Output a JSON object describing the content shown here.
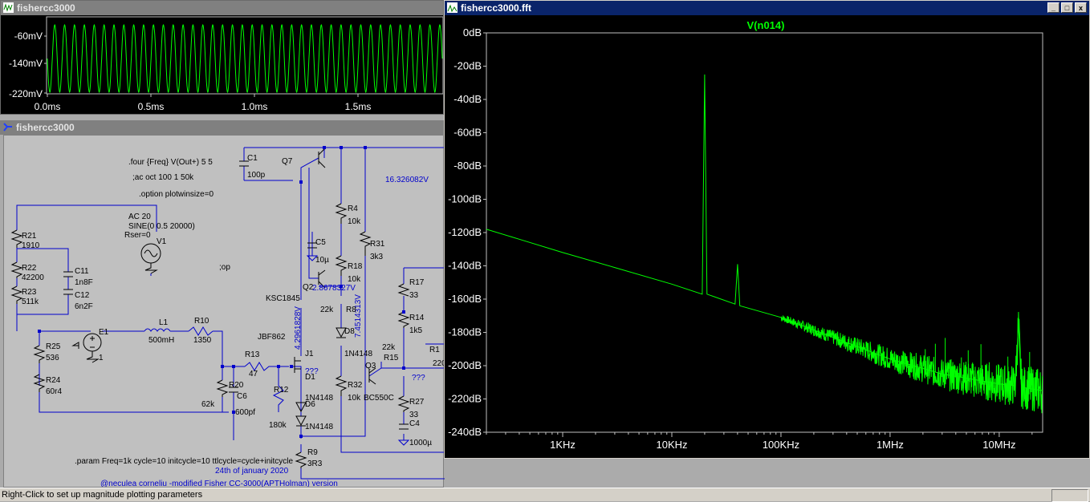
{
  "waveform_window": {
    "title": "fishercc3000",
    "y_ticks": [
      "-60mV",
      "-140mV",
      "-220mV"
    ],
    "x_ticks": [
      "0.0ms",
      "0.5ms",
      "1.0ms",
      "1.5ms"
    ]
  },
  "schematic_window": {
    "title": "fishercc3000",
    "directives": {
      "four": ".four {Freq} V(Out+) 5 5",
      "ac": ";ac oct 100 1 50k",
      "option": ".option plotwinsize=0",
      "op": ";op",
      "param": ".param Freq=1k cycle=10 initcycle=10 ttlcycle=cycle+initcycle"
    },
    "source": {
      "name": "V1",
      "ac": "AC 20",
      "sine": "SINE(0 0.5 20000)",
      "rser": "Rser=0"
    },
    "node_voltages": [
      "16.326082V",
      "2.8678327V",
      "4.2961828V",
      "7.4514313V"
    ],
    "unknowns": [
      "???",
      "???"
    ],
    "components": [
      {
        "ref": "R21",
        "val": "1910"
      },
      {
        "ref": "R22",
        "val": "42200"
      },
      {
        "ref": "R23",
        "val": "511k"
      },
      {
        "ref": "C11",
        "val": "1n8F"
      },
      {
        "ref": "C12",
        "val": "6n2F"
      },
      {
        "ref": "R25",
        "val": "536"
      },
      {
        "ref": "R24",
        "val": "60r4"
      },
      {
        "ref": "E1",
        "val": "1"
      },
      {
        "ref": "L1",
        "val": "500mH"
      },
      {
        "ref": "R10",
        "val": "1350"
      },
      {
        "ref": "R13",
        "val": "47"
      },
      {
        "ref": "R20",
        "val": "62k"
      },
      {
        "ref": "C6",
        "val": "600pf"
      },
      {
        "ref": "R12",
        "val": "180k"
      },
      {
        "ref": "J1",
        "val": "JBF862"
      },
      {
        "ref": "D1",
        "val": "1N4148"
      },
      {
        "ref": "D6",
        "val": "1N4148"
      },
      {
        "ref": "R9",
        "val": "3R3"
      },
      {
        "ref": "C1",
        "val": "100p"
      },
      {
        "ref": "Q7",
        "val": ""
      },
      {
        "ref": "C5",
        "val": "10µ"
      },
      {
        "ref": "Q2",
        "val": "KSC1845"
      },
      {
        "ref": "R4",
        "val": "10k"
      },
      {
        "ref": "R18",
        "val": "10k"
      },
      {
        "ref": "R8",
        "val": "22k"
      },
      {
        "ref": "D8",
        "val": "1N4148"
      },
      {
        "ref": "R32",
        "val": "10k"
      },
      {
        "ref": "R31",
        "val": "3k3"
      },
      {
        "ref": "Q3",
        "val": "BC550C"
      },
      {
        "ref": "R17",
        "val": "33"
      },
      {
        "ref": "R14",
        "val": "1k5"
      },
      {
        "ref": "R15",
        "val": "22k"
      },
      {
        "ref": "R1",
        "val": "220"
      },
      {
        "ref": "R27",
        "val": "33"
      },
      {
        "ref": "C4",
        "val": "1000µ"
      }
    ],
    "date": "24th of january 2020",
    "credit": "@neculea corneliu -modified Fisher CC-3000(APTHolman) version"
  },
  "fft_window": {
    "title": "fishercc3000.fft",
    "controls": [
      "_",
      "□",
      "x"
    ],
    "trace_label": "V(n014)"
  },
  "chart_data": {
    "type": "line",
    "title": "V(n014)",
    "xscale": "log",
    "yunit": "dB",
    "xlim": [
      200,
      25000000
    ],
    "ylim": [
      -240,
      0
    ],
    "y_ticks": [
      "0dB",
      "-20dB",
      "-40dB",
      "-60dB",
      "-80dB",
      "-100dB",
      "-120dB",
      "-140dB",
      "-160dB",
      "-180dB",
      "-200dB",
      "-220dB",
      "-240dB"
    ],
    "x_ticks": [
      "1KHz",
      "10KHz",
      "100KHz",
      "1MHz",
      "10MHz"
    ],
    "series": [
      {
        "color": "#00ff00",
        "x": [
          200,
          400,
          1000,
          3000,
          10000,
          19000,
          20000,
          21000,
          38000,
          40000,
          42000,
          100000,
          300000,
          1000000,
          3000000,
          10000000,
          14000000,
          15000000,
          16000000,
          25000000
        ],
        "y": [
          -118,
          -124,
          -132,
          -141,
          -151,
          -157,
          -25,
          -157,
          -163,
          -139,
          -164,
          -171,
          -183,
          -196,
          -205,
          -211,
          -212,
          -175,
          -213,
          -215
        ]
      }
    ]
  },
  "status_bar": {
    "text": "Right-Click to set up magnitude plotting parameters"
  },
  "colors": {
    "trace": "#00ff00",
    "wire": "#0000cc",
    "grid": "#c0c0c0",
    "background": "#000000"
  }
}
